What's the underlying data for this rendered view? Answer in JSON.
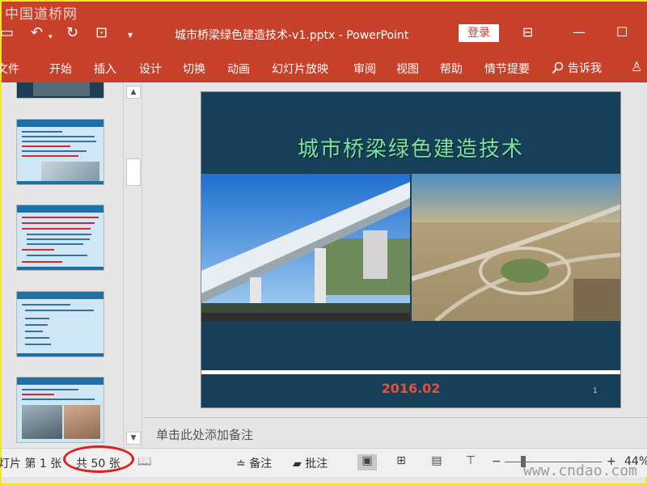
{
  "watermarks": {
    "top": "中国道桥网",
    "bottom": "www.cndao.com"
  },
  "titlebar": {
    "title": "城市桥梁绿色建造技术-v1.pptx  -  PowerPoint",
    "login": "登录",
    "colors": {
      "accent": "#c7402a"
    }
  },
  "ribbon": {
    "tabs": [
      "文件",
      "开始",
      "插入",
      "设计",
      "切换",
      "动画",
      "幻灯片放映",
      "审阅",
      "视图",
      "帮助",
      "情节提要"
    ],
    "tellme": "告诉我"
  },
  "slide": {
    "title": "城市桥梁绿色建造技术",
    "date": "2016.02",
    "number": "1"
  },
  "notes": {
    "placeholder": "单击此处添加备注"
  },
  "statusbar": {
    "slide_pos": "灯片 第 1 张",
    "slide_total": "共 50 张",
    "notes_btn": "备注",
    "comments_btn": "批注",
    "zoom_minus": "−",
    "zoom_plus": "+",
    "zoom_level": "44%"
  }
}
